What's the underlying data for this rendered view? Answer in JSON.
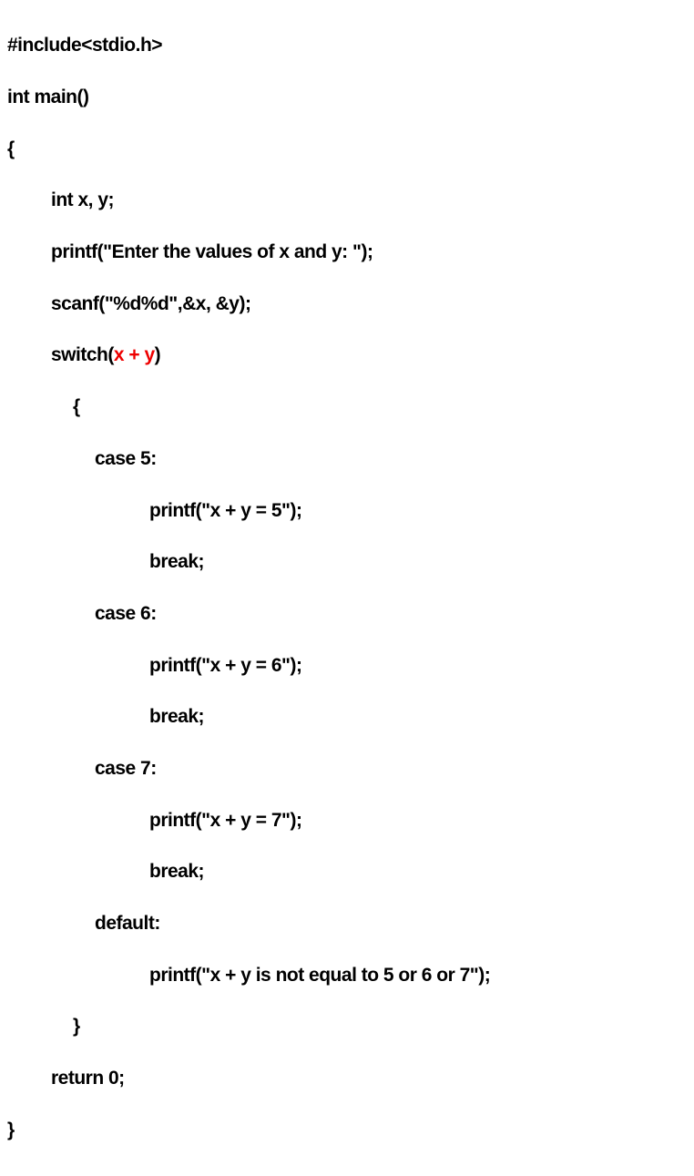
{
  "code": {
    "l1": "#include<stdio.h>",
    "l2": "int main()",
    "l3": "{",
    "l4": "int x, y;",
    "l5": "printf(\"Enter the values of x and y: \");",
    "l6": "scanf(\"%d%d\",&x, &y);",
    "l7a": "switch(",
    "l7b": "x + y",
    "l7c": ")",
    "l8": "{",
    "l9": "case 5:",
    "l10": "printf(\"x + y = 5\");",
    "l11": "break;",
    "l12": "case 6:",
    "l13": "printf(\"x + y = 6\");",
    "l14": "break;",
    "l15": "case 7:",
    "l16": "printf(\"x + y = 7\");",
    "l17": "break;",
    "l18": "default:",
    "l19": "printf(\"x + y is not equal to 5 or 6 or 7\");",
    "l20": "}",
    "l21": "return 0;",
    "l22": "}"
  }
}
